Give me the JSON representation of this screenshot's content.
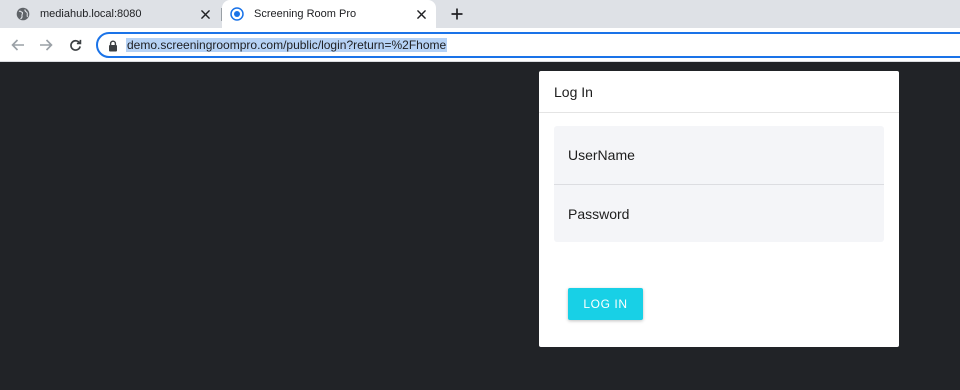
{
  "browser": {
    "tabs": [
      {
        "title": "mediahub.local:8080",
        "icon": "globe-icon",
        "active": false
      },
      {
        "title": "Screening Room Pro",
        "icon": "radio-favicon-icon",
        "active": true
      }
    ],
    "address_bar": {
      "url": "demo.screeningroompro.com/public/login?return=%2Fhome",
      "selected": true
    }
  },
  "login_card": {
    "title": "Log In",
    "username_placeholder": "UserName",
    "password_placeholder": "Password",
    "submit_label": "LOG IN"
  },
  "colors": {
    "page_background": "#212327",
    "accent_button": "#18d0e6",
    "omnibox_focus": "#1a73e8"
  }
}
